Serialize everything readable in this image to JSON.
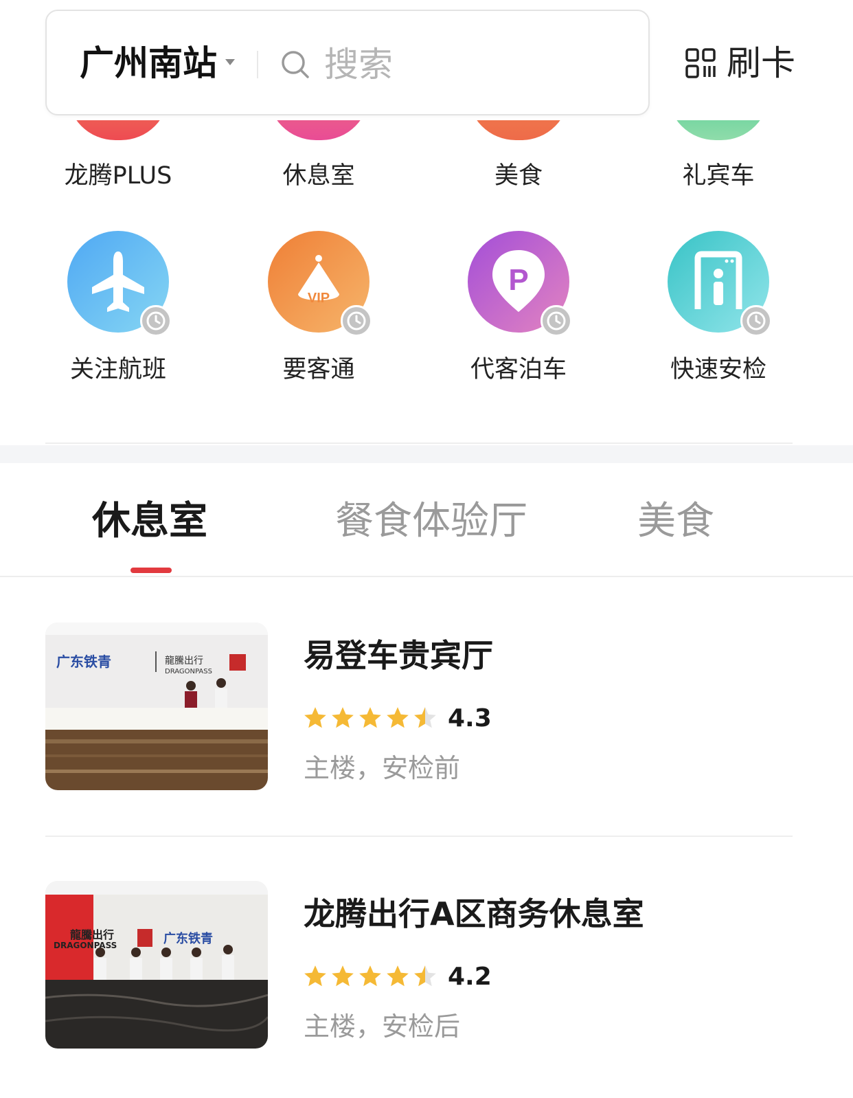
{
  "header": {
    "city": "广州南站",
    "search_placeholder": "搜索",
    "scan_label": "刷卡"
  },
  "quick_row1": [
    {
      "label": "龙腾PLUS",
      "color": "#ee4b52"
    },
    {
      "label": "休息室",
      "color": "#ea4a8d"
    },
    {
      "label": "美食",
      "color": "#ef6c4b"
    },
    {
      "label": "礼宾车",
      "color": "#6dd49d"
    }
  ],
  "quick_row2": [
    {
      "label": "关注航班",
      "icon": "airplane-icon",
      "colors": [
        "#5ab2f4",
        "#7cd0f2"
      ]
    },
    {
      "label": "要客通",
      "icon": "vip-crown-icon",
      "colors": [
        "#f08a3c",
        "#f6b36a"
      ]
    },
    {
      "label": "代客泊车",
      "icon": "parking-pin-icon",
      "colors": [
        "#a855d8",
        "#e080c2"
      ]
    },
    {
      "label": "快速安检",
      "icon": "security-gate-icon",
      "colors": [
        "#3ec7c9",
        "#8ae2e6"
      ]
    }
  ],
  "tabs": [
    {
      "label": "休息室",
      "active": true
    },
    {
      "label": "餐食体验厅",
      "active": false
    },
    {
      "label": "美食",
      "active": false
    }
  ],
  "lounges": [
    {
      "title": "易登车贵宾厅",
      "rating": "4.3",
      "location": "主楼，安检前"
    },
    {
      "title": "龙腾出行A区商务休息室",
      "rating": "4.2",
      "location": "主楼，安检后"
    }
  ],
  "colors": {
    "accent": "#e23a3f",
    "star": "#f5b935"
  }
}
